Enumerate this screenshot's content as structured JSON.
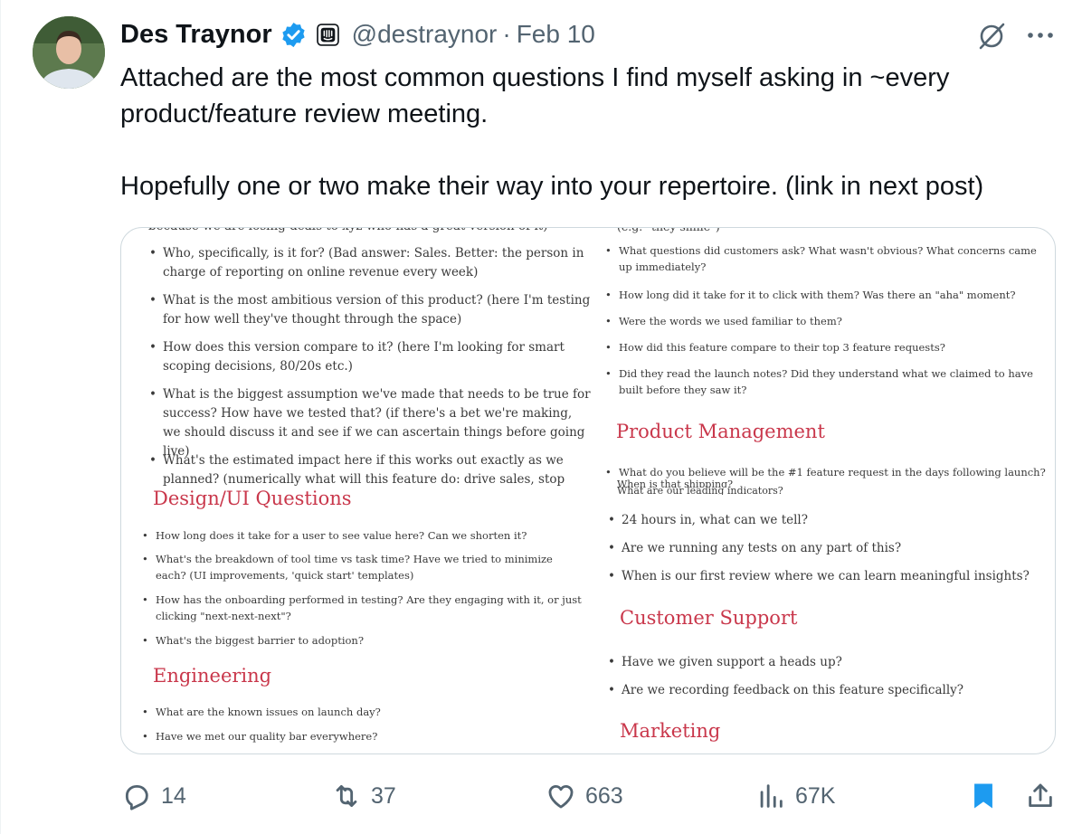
{
  "tweet": {
    "author_name": "Des Traynor",
    "handle": "@destraynor",
    "separator": "·",
    "date": "Feb 10",
    "text_p1": "Attached are the most common questions I find myself asking in ~every product/feature review meeting.",
    "text_p2": "Hopefully one or two make their way into your repertoire. (link in next post)"
  },
  "image": {
    "left_cutoff_top": "because we are losing deals to xyz who has a great version of it)",
    "left_items": [
      "Who, specifically, is it for? (Bad answer: Sales. Better: the person in charge of reporting on online revenue every week)",
      "What is the most ambitious version of this product? (here I'm testing for how well they've thought through the space)",
      "How does this version compare to it? (here I'm looking for smart scoping decisions, 80/20s etc.)",
      "What is the biggest assumption we've made that needs to be true for success? How have we tested that? (if there's a bet we're making, we should discuss it and see if we can ascertain things before going live)",
      "What's the estimated impact here if this works out exactly as we planned? (numerically what will this feature do: drive sales, stop churn, change"
    ],
    "design_heading": "Design/UI Questions",
    "design_items": [
      "How long does it take for a user to see value here? Can we shorten it?",
      "What's the breakdown of tool time vs task time? Have we tried to minimize each? (UI improvements, 'quick start' templates)",
      "How has the onboarding performed in testing? Are they engaging with it, or just clicking \"next-next-next\"?",
      "What's the biggest barrier to adoption?"
    ],
    "engineering_heading": "Engineering",
    "engineering_items": [
      "What are the known issues on launch day?",
      "Have we met our quality bar everywhere?"
    ],
    "right_cutoff_top": "(e.g. \"they smile\")",
    "right_items": [
      "What questions did customers ask? What wasn't obvious? What concerns came up immediately?",
      "How long did it take for it to click with them? Was there an \"aha\" moment?",
      "Were the words we used familiar to them?",
      "How did this feature compare to their top 3 feature requests?",
      "Did they read the launch notes? Did they understand what we claimed to have built before they saw it?"
    ],
    "pm_heading": "Product Management",
    "pm_item": "What do you believe will be the #1 feature request in the days following launch?",
    "pm_cut_1": "When is that shipping?",
    "pm_cut_2": "What are our leading indicators?",
    "pm_items": [
      "24 hours in, what can we tell?",
      "Are we running any tests on any part of this?",
      "When is our first review where we can learn meaningful insights?"
    ],
    "cs_heading": "Customer Support",
    "cs_items": [
      "Have we given support a heads up?",
      "Are we recording feedback on this feature specifically?"
    ],
    "marketing_heading": "Marketing"
  },
  "actions": {
    "replies": "14",
    "reposts": "37",
    "likes": "663",
    "views": "67K"
  },
  "colors": {
    "accent": "#1d9bf0",
    "muted": "#536471",
    "heading_red": "#c9374b"
  },
  "icons": [
    "verified-badge-icon",
    "company-logo-icon",
    "grok-icon",
    "more-icon",
    "reply-icon",
    "repost-icon",
    "like-icon",
    "views-icon",
    "bookmark-icon",
    "share-icon"
  ]
}
